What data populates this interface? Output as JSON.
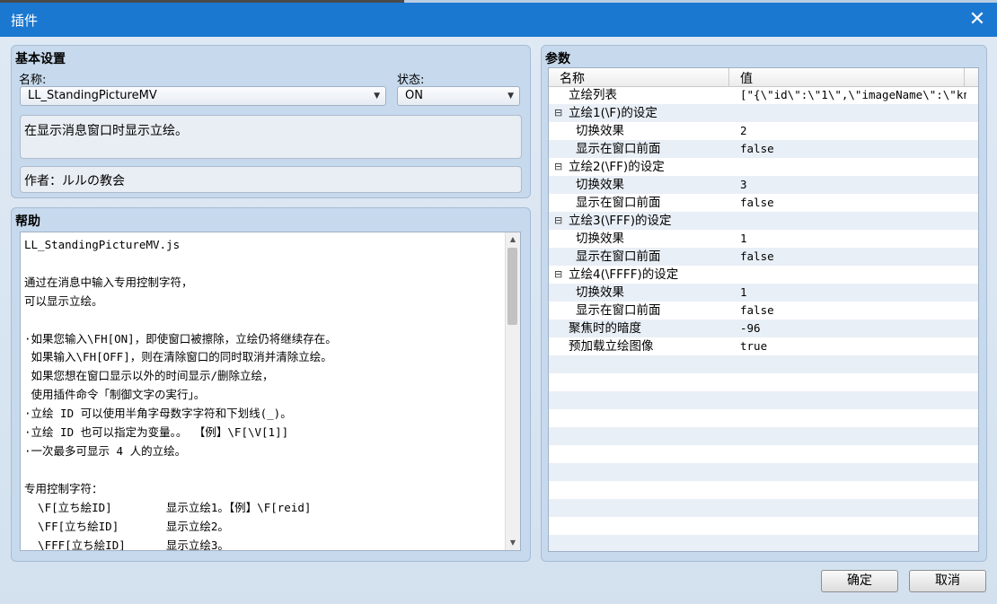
{
  "window": {
    "title": "插件",
    "close_icon": "close-icon"
  },
  "basic": {
    "section_title": "基本设置",
    "name_label": "名称:",
    "name_value": "LL_StandingPictureMV",
    "status_label": "状态:",
    "status_value": "ON",
    "description": "在显示消息窗口时显示立绘。",
    "author": "作者：ルルの教会"
  },
  "help": {
    "section_title": "帮助",
    "text": "LL_StandingPictureMV.js\n\n通过在消息中输入专用控制字符，\n可以显示立绘。\n\n·如果您输入\\FH[ON]，即使窗口被擦除，立绘仍将继续存在。\n 如果输入\\FH[OFF]，则在清除窗口的同时取消并清除立绘。\n 如果您想在窗口显示以外的时间显示/删除立绘，\n 使用插件命令「制御文字の実行」。\n·立绘 ID 可以使用半角字母数字字符和下划线(_)。\n·立绘 ID 也可以指定为变量。。 【例】\\F[\\V[1]]\n·一次最多可显示 4 人的立绘。\n\n专用控制字符：\n  \\F[立ち絵ID]        显示立绘1。【例】\\F[reid]\n  \\FF[立ち絵ID]       显示立绘2。\n  \\FFF[立ち絵ID]      显示立绘3。"
  },
  "params": {
    "section_title": "参数",
    "col_name": "名称",
    "col_value": "值",
    "rows": [
      {
        "name": "立绘列表",
        "value": "[\"{\\\"id\\\":\\\"1\\\",\\\"imageName\\\":\\\"kn…",
        "level": 1,
        "group": false
      },
      {
        "name": "立绘1(\\F)的设定",
        "value": "",
        "level": 0,
        "group": true,
        "toggle": "⊟"
      },
      {
        "name": "切换效果",
        "value": "2",
        "level": 2,
        "group": false
      },
      {
        "name": "显示在窗口前面",
        "value": "false",
        "level": 2,
        "group": false
      },
      {
        "name": "立绘2(\\FF)的设定",
        "value": "",
        "level": 0,
        "group": true,
        "toggle": "⊟"
      },
      {
        "name": "切换效果",
        "value": "3",
        "level": 2,
        "group": false
      },
      {
        "name": "显示在窗口前面",
        "value": "false",
        "level": 2,
        "group": false
      },
      {
        "name": "立绘3(\\FFF)的设定",
        "value": "",
        "level": 0,
        "group": true,
        "toggle": "⊟"
      },
      {
        "name": "切换效果",
        "value": "1",
        "level": 2,
        "group": false
      },
      {
        "name": "显示在窗口前面",
        "value": "false",
        "level": 2,
        "group": false
      },
      {
        "name": "立绘4(\\FFFF)的设定",
        "value": "",
        "level": 0,
        "group": true,
        "toggle": "⊟"
      },
      {
        "name": "切换效果",
        "value": "1",
        "level": 2,
        "group": false
      },
      {
        "name": "显示在窗口前面",
        "value": "false",
        "level": 2,
        "group": false
      },
      {
        "name": "聚焦时的暗度",
        "value": "-96",
        "level": 1,
        "group": false
      },
      {
        "name": "预加载立绘图像",
        "value": "true",
        "level": 1,
        "group": false
      }
    ]
  },
  "buttons": {
    "ok": "确定",
    "cancel": "取消"
  }
}
